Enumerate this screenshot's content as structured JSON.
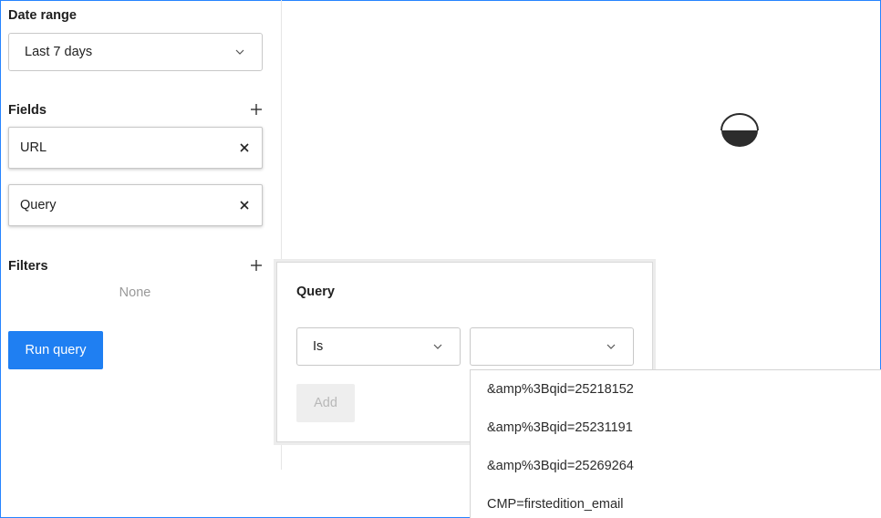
{
  "sidebar": {
    "date_range": {
      "title": "Date range",
      "selected": "Last 7 days"
    },
    "fields": {
      "title": "Fields",
      "items": [
        "URL",
        "Query"
      ]
    },
    "filters": {
      "title": "Filters",
      "empty_text": "None"
    },
    "run_button": "Run query"
  },
  "filter_popover": {
    "title": "Query",
    "operator": "Is",
    "value": "",
    "add_button": "Add"
  },
  "value_options": [
    "&amp%3Bqid=25218152",
    "&amp%3Bqid=25231191",
    "&amp%3Bqid=25269264",
    "CMP=firstedition_email"
  ],
  "colors": {
    "accent": "#1f7ff2",
    "focus_border": "#2684ff"
  },
  "icons": {
    "add": "plus-icon",
    "remove": "close-icon",
    "dropdown": "chevron-down-icon",
    "loading": "spinner-icon"
  }
}
